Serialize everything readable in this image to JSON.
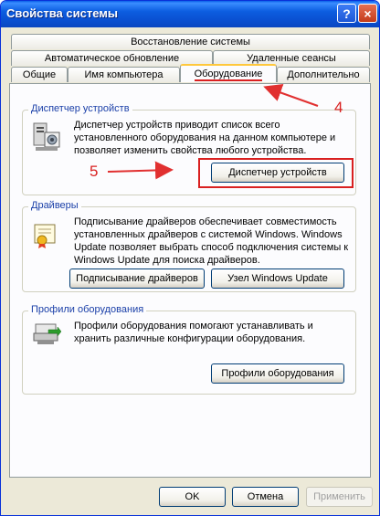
{
  "window": {
    "title": "Свойства системы",
    "help_glyph": "?",
    "close_glyph": "×"
  },
  "tabs": {
    "row1": [
      "Восстановление системы"
    ],
    "row2": [
      "Автоматическое обновление",
      "Удаленные сеансы"
    ],
    "row3": [
      "Общие",
      "Имя компьютера",
      "Оборудование",
      "Дополнительно"
    ],
    "active": "Оборудование"
  },
  "device_manager": {
    "group_label": "Диспетчер устройств",
    "description": "Диспетчер устройств приводит список всего установленного оборудования на данном компьютере и позволяет изменить свойства любого устройства.",
    "button_label": "Диспетчер устройств"
  },
  "drivers": {
    "group_label": "Драйверы",
    "description": "Подписывание драйверов обеспечивает совместимость установленных драйверов с системой Windows.  Windows Update позволяет выбрать способ подключения системы к Windows Update для поиска драйверов.",
    "signing_button_label": "Подписывание драйверов",
    "update_button_label": "Узел Windows Update"
  },
  "hardware_profiles": {
    "group_label": "Профили оборудования",
    "description": "Профили оборудования помогают устанавливать и хранить различные конфигурации оборудования.",
    "button_label": "Профили оборудования"
  },
  "footer": {
    "ok_label": "OK",
    "cancel_label": "Отмена",
    "apply_label": "Применить"
  },
  "annotations": {
    "step_tab": "4",
    "step_button": "5",
    "color": "#d92020"
  },
  "icons": [
    "help-icon",
    "close-icon",
    "device-manager-icon",
    "driver-certificate-icon",
    "hardware-profile-icon"
  ]
}
